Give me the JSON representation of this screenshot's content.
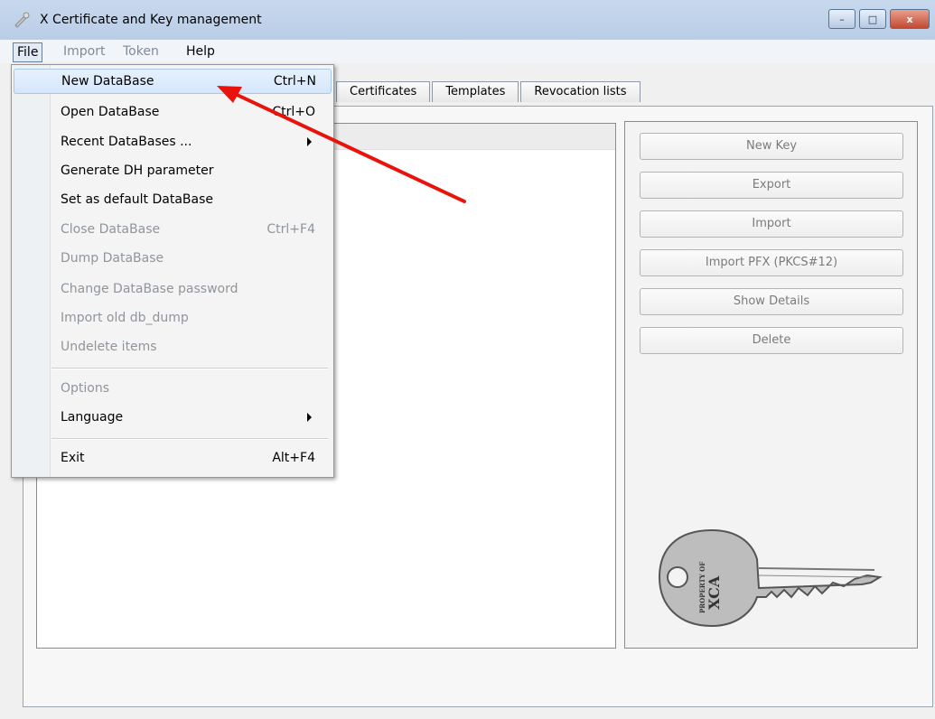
{
  "window": {
    "title": "X Certificate and Key management",
    "buttons": {
      "minimize": "–",
      "maximize": "□",
      "close": "x"
    }
  },
  "menubar": {
    "items": [
      {
        "label": "File",
        "state": "active"
      },
      {
        "label": "Import",
        "state": "disabled"
      },
      {
        "label": "Token",
        "state": "disabled"
      },
      {
        "label": "Help",
        "state": "normal"
      }
    ]
  },
  "file_menu": {
    "items": [
      {
        "label": "New DataBase",
        "shortcut": "Ctrl+N",
        "enabled": true,
        "highlighted": true
      },
      {
        "label": "Open DataBase",
        "shortcut": "Ctrl+O",
        "enabled": true
      },
      {
        "label": "Recent DataBases ...",
        "shortcut": "",
        "enabled": true,
        "submenu": true
      },
      {
        "label": "Generate DH parameter",
        "shortcut": "",
        "enabled": true
      },
      {
        "label": "Set as default DataBase",
        "shortcut": "",
        "enabled": true
      },
      {
        "label": "Close DataBase",
        "shortcut": "Ctrl+F4",
        "enabled": false
      },
      {
        "label": "Dump DataBase",
        "shortcut": "",
        "enabled": false
      },
      {
        "label": "Change DataBase password",
        "shortcut": "",
        "enabled": false
      },
      {
        "label": "Import old db_dump",
        "shortcut": "",
        "enabled": false
      },
      {
        "label": "Undelete items",
        "shortcut": "",
        "enabled": false
      },
      {
        "label": "Options",
        "shortcut": "",
        "enabled": false
      },
      {
        "label": "Language",
        "shortcut": "",
        "enabled": true,
        "submenu": true
      },
      {
        "label": "Exit",
        "shortcut": "Alt+F4",
        "enabled": true
      }
    ]
  },
  "tabs": [
    "Certificates",
    "Templates",
    "Revocation lists"
  ],
  "actions": [
    "New Key",
    "Export",
    "Import",
    "Import PFX (PKCS#12)",
    "Show Details",
    "Delete"
  ],
  "key_image": {
    "line1": "PROPERTY OF",
    "line2": "XCA"
  },
  "colors": {
    "annotation_arrow": "#e8140c",
    "highlight": "#d5e6fb"
  }
}
